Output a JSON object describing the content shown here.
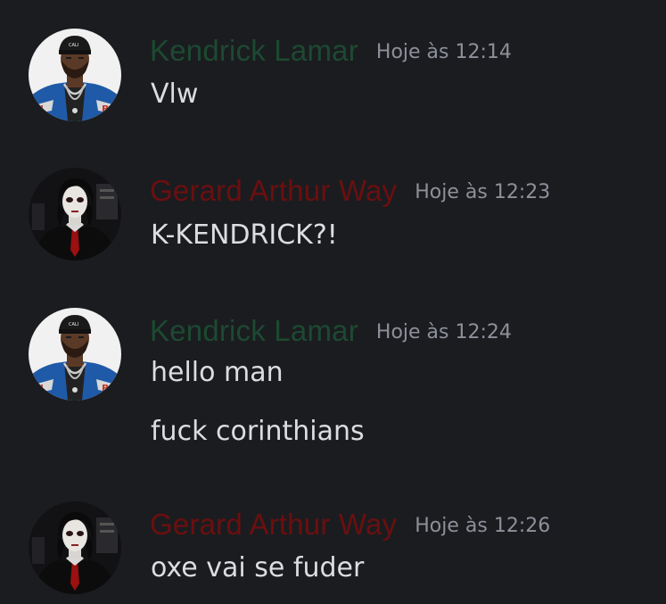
{
  "colors": {
    "background": "#1b1c20",
    "kendrick_name": "#1c4a31",
    "gerard_name": "#6b0f0f",
    "timestamp": "#8e9099",
    "message_text": "#dcdde1"
  },
  "messages": [
    {
      "author": "Kendrick Lamar",
      "avatar": "kendrick-avatar",
      "timestamp": "Hoje às 12:14",
      "lines": [
        "Vlw"
      ]
    },
    {
      "author": "Gerard Arthur Way",
      "avatar": "gerard-avatar",
      "timestamp": "Hoje às 12:23",
      "lines": [
        "K-KENDRICK?!"
      ]
    },
    {
      "author": "Kendrick Lamar",
      "avatar": "kendrick-avatar",
      "timestamp": "Hoje às 12:24",
      "lines": [
        "hello man",
        "fuck corinthians"
      ]
    },
    {
      "author": "Gerard Arthur Way",
      "avatar": "gerard-avatar",
      "timestamp": "Hoje às 12:26",
      "lines": [
        "oxe vai se fuder"
      ]
    }
  ]
}
